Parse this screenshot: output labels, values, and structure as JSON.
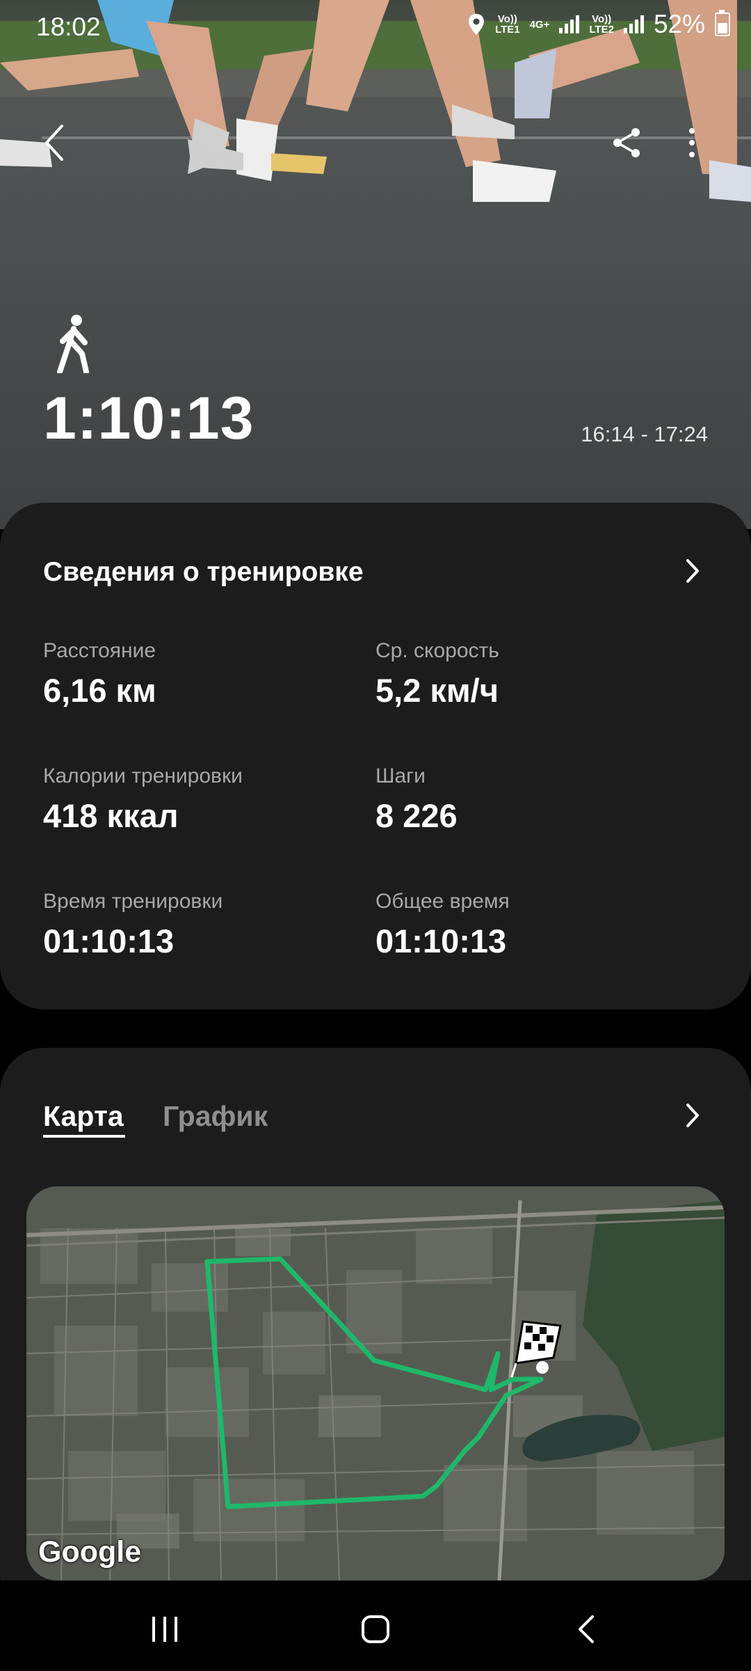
{
  "status_bar": {
    "time": "18:02",
    "sim1": "Vo))\nLTE1",
    "network": "4G+",
    "sim2": "Vo))\nLTE2",
    "battery": "52%"
  },
  "hero": {
    "duration": "1:10:13",
    "time_range": "16:14 - 17:24",
    "activity_icon": "walking-person-icon"
  },
  "summary": {
    "title": "Сведения о тренировке",
    "stats": [
      {
        "label": "Расстояние",
        "value": "6,16 км"
      },
      {
        "label": "Ср. скорость",
        "value": "5,2 км/ч"
      },
      {
        "label": "Калории тренировки",
        "value": "418 ккал"
      },
      {
        "label": "Шаги",
        "value": "8 226"
      },
      {
        "label": "Время тренировки",
        "value": "01:10:13"
      },
      {
        "label": "Общее время",
        "value": "01:10:13"
      }
    ]
  },
  "map_section": {
    "tabs": [
      {
        "label": "Карта",
        "active": true
      },
      {
        "label": "График",
        "active": false
      }
    ],
    "attribution": "Google",
    "route_color": "#1fb86a"
  },
  "colors": {
    "card_bg": "#1c1c1c",
    "label": "#a8a8a8"
  }
}
